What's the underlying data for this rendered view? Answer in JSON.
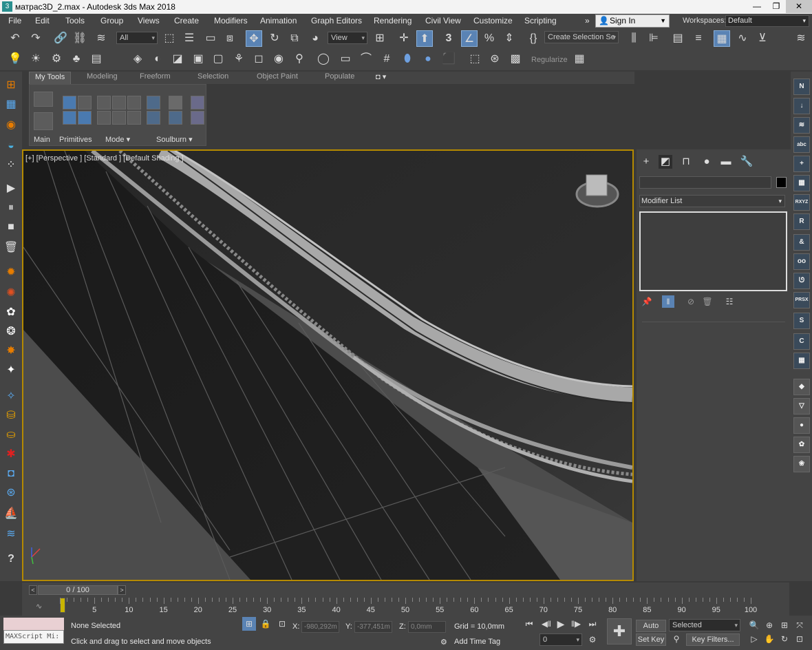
{
  "window": {
    "title": "матрас3D_2.max - Autodesk 3ds Max 2018",
    "app_icon": "3",
    "minimize": "—",
    "restore": "❐",
    "close": "✕"
  },
  "menubar": {
    "items": [
      "File",
      "Edit",
      "Tools",
      "Group",
      "Views",
      "Create",
      "Modifiers",
      "Animation",
      "Graph Editors",
      "Rendering",
      "Civil View",
      "Customize",
      "Scripting"
    ],
    "overflow": "»",
    "sign_in": "Sign In",
    "workspaces_label": "Workspaces:",
    "workspaces_value": "Default"
  },
  "main_toolbar": {
    "selection_filter": "All",
    "reference_coord": "View",
    "named_selection": "Create Selection Se",
    "snap_label": "3"
  },
  "second_toolbar": {
    "regularize": "Regularize"
  },
  "ribbon": {
    "tabs": [
      "My Tools",
      "Modeling",
      "Freeform",
      "Selection",
      "Object Paint",
      "Populate"
    ],
    "groups": [
      "Main",
      "Primitives",
      "Mode",
      "Soulburn"
    ]
  },
  "viewport": {
    "label": "[+] [Perspective ] [Standard ] [Default Shading ]"
  },
  "command_panel": {
    "modifier_list": "Modifier List",
    "swatch_color": "#000000"
  },
  "rightbar": {
    "icons": [
      "N",
      "↓",
      "≋",
      "abc",
      "+",
      "▦",
      "RXYZ",
      "R",
      "&",
      "oo",
      "ᘎ",
      "PRSX",
      "S",
      "C",
      "▦",
      "◆",
      "▽",
      "●",
      "✿",
      "❀"
    ]
  },
  "timeline": {
    "slider": "0 / 100",
    "ticks": [
      5,
      10,
      15,
      20,
      25,
      30,
      35,
      40,
      45,
      50,
      55,
      60,
      65,
      70,
      75,
      80,
      85,
      90,
      95,
      100
    ],
    "prev": "<",
    "next": ">"
  },
  "statusbar": {
    "maxscript_placeholder": "MAXScript Mi:",
    "selection": "None Selected",
    "prompt": "Click and drag to select and move objects",
    "x_label": "X:",
    "x_value": "-980,292m",
    "y_label": "Y:",
    "y_value": "-377,451m",
    "z_label": "Z:",
    "z_value": "0,0mm",
    "grid": "Grid = 10,0mm",
    "add_time_tag": "Add Time Tag",
    "auto_key": "Auto Key",
    "set_key": "Set Key",
    "selected": "Selected",
    "key_filters": "Key Filters...",
    "frame": "0"
  },
  "colors": {
    "viewport_border": "#b58a00",
    "active_button": "#5a83b4",
    "maxscript_bg": "#e9d0d3"
  }
}
